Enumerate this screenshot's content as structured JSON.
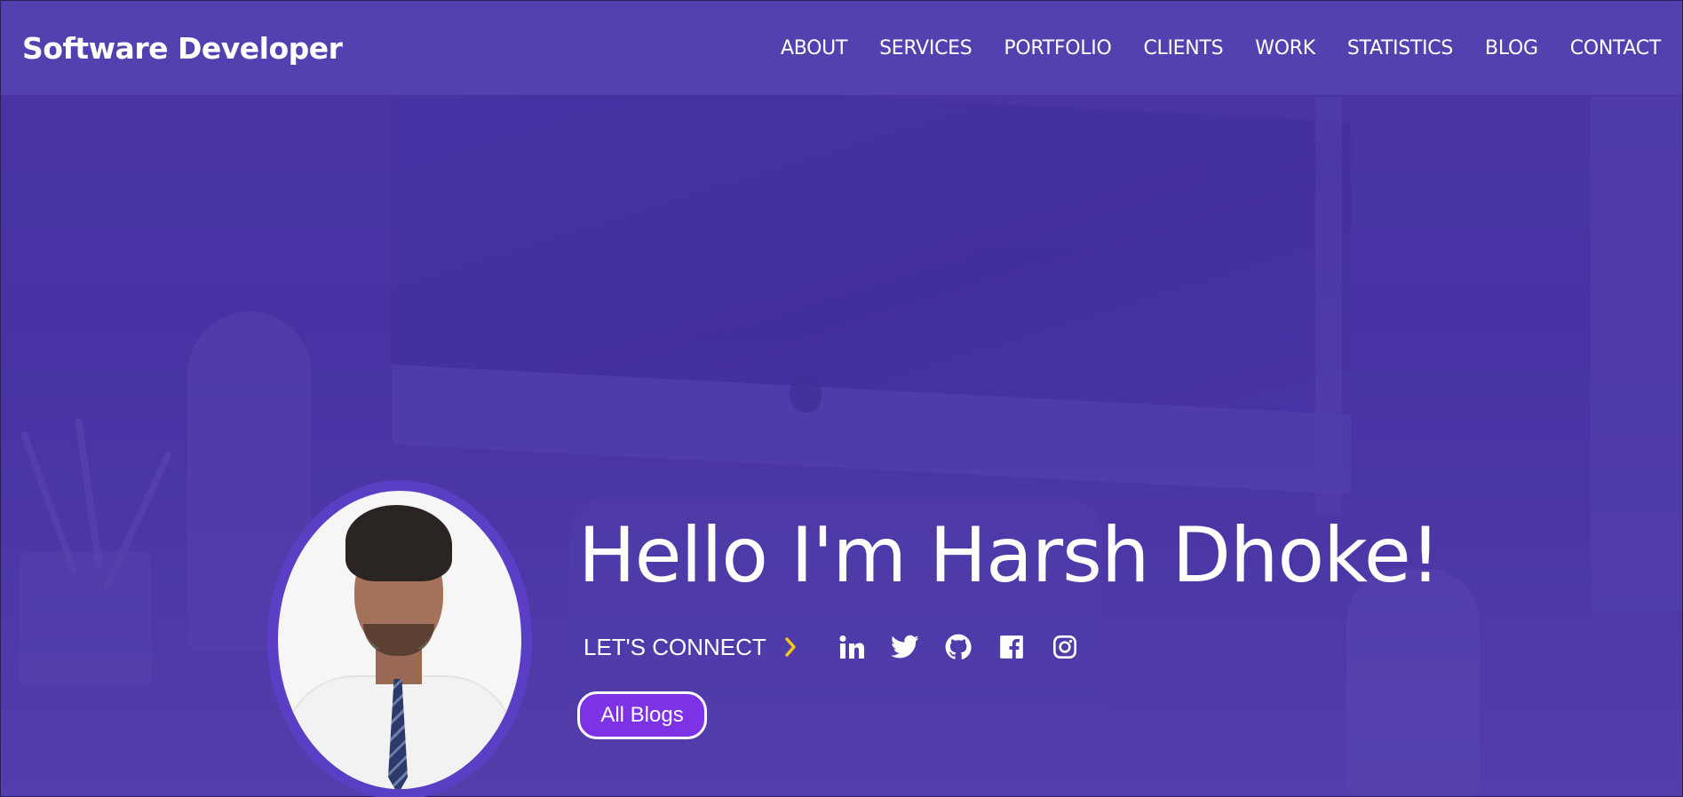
{
  "brand": {
    "title": "Software Developer"
  },
  "nav": {
    "items": [
      {
        "label": "ABOUT"
      },
      {
        "label": "SERVICES"
      },
      {
        "label": "PORTFOLIO"
      },
      {
        "label": "CLIENTS"
      },
      {
        "label": "WORK"
      },
      {
        "label": "STATISTICS"
      },
      {
        "label": "BLOG"
      },
      {
        "label": "CONTACT"
      }
    ]
  },
  "hero": {
    "title": "Hello I'm Harsh Dhoke!",
    "connect_label": "LET'S CONNECT",
    "socials": [
      {
        "icon": "linkedin-icon"
      },
      {
        "icon": "twitter-icon"
      },
      {
        "icon": "github-icon"
      },
      {
        "icon": "facebook-icon"
      },
      {
        "icon": "instagram-icon"
      }
    ],
    "button_label": "All Blogs"
  },
  "colors": {
    "navbar": "#5540b0",
    "hero_bg": "#4a35a0",
    "button_bg": "#7e32e6",
    "chevron": "#f5c518",
    "text": "#ffffff"
  }
}
